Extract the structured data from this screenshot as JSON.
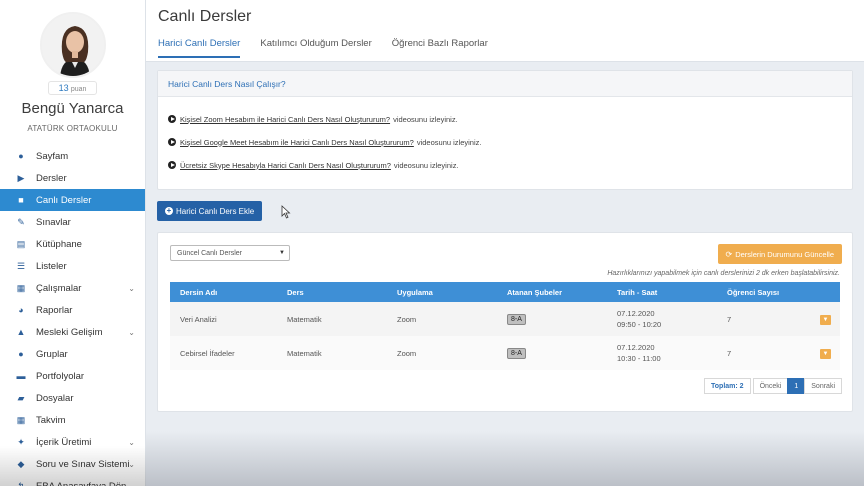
{
  "profile": {
    "points": "13",
    "points_label": "puan",
    "name": "Bengü Yanarca",
    "school": "ATATÜRK ORTAOKULU"
  },
  "sidebar": {
    "items": [
      {
        "label": "Sayfam",
        "icon": "user-icon",
        "glyph": "●"
      },
      {
        "label": "Dersler",
        "icon": "play-circle-icon",
        "glyph": "▶"
      },
      {
        "label": "Canlı Dersler",
        "icon": "video-camera-icon",
        "glyph": "■"
      },
      {
        "label": "Sınavlar",
        "icon": "pencil-icon",
        "glyph": "✎"
      },
      {
        "label": "Kütüphane",
        "icon": "book-icon",
        "glyph": "▤"
      },
      {
        "label": "Listeler",
        "icon": "list-icon",
        "glyph": "☰"
      },
      {
        "label": "Çalışmalar",
        "icon": "tasks-icon",
        "glyph": "▦"
      },
      {
        "label": "Raporlar",
        "icon": "pie-chart-icon",
        "glyph": "◕"
      },
      {
        "label": "Mesleki Gelişim",
        "icon": "graduation-icon",
        "glyph": "▲"
      },
      {
        "label": "Gruplar",
        "icon": "users-icon",
        "glyph": "●"
      },
      {
        "label": "Portfolyolar",
        "icon": "briefcase-icon",
        "glyph": "▬"
      },
      {
        "label": "Dosyalar",
        "icon": "folder-icon",
        "glyph": "▰"
      },
      {
        "label": "Takvim",
        "icon": "calendar-icon",
        "glyph": "▦"
      },
      {
        "label": "İçerik Üretimi",
        "icon": "content-icon",
        "glyph": "✦"
      },
      {
        "label": "Soru ve Sınav Sistemi",
        "icon": "question-icon",
        "glyph": "◆"
      },
      {
        "label": "EBA Anasayfaya Dön",
        "icon": "back-arrow-icon",
        "glyph": "↰"
      }
    ],
    "active_index": 2
  },
  "page": {
    "title": "Canlı Dersler",
    "tabs": [
      "Harici Canlı Dersler",
      "Katılımcı Olduğum Dersler",
      "Öğrenci Bazlı Raporlar"
    ],
    "active_tab": 0
  },
  "info": {
    "title": "Harici Canlı Ders Nasıl Çalışır?",
    "rows": [
      {
        "link": "Kişisel Zoom Hesabım ile Harici Canlı Ders Nasıl Oluştururum?",
        "suffix": "videosunu izleyiniz."
      },
      {
        "link": "Kişisel Google Meet Hesabım ile Harici Canlı Ders Nasıl Oluştururum?",
        "suffix": "videosunu izleyiniz."
      },
      {
        "link": "Ücretsiz Skype Hesabıyla Harici Canlı Ders Nasıl Oluştururum?",
        "suffix": "videosunu izleyiniz."
      }
    ]
  },
  "add_button": "Harici Canlı Ders Ekle",
  "filter": {
    "selected": "Güncel Canlı Dersler"
  },
  "update_button": "Derslerin Durumunu Güncelle",
  "hint": "Hazırlıklarınızı yapabilmek için canlı derslerinizi 2 dk erken başlatabilirsiniz.",
  "table": {
    "headers": [
      "Dersin Adı",
      "Ders",
      "Uygulama",
      "Atanan Şubeler",
      "Tarih - Saat",
      "Öğrenci Sayısı"
    ],
    "rows": [
      {
        "name": "Veri Analizi",
        "course": "Matematik",
        "app": "Zoom",
        "branch": "8-A",
        "date": "07.12.2020",
        "time": "09:50 - 10:20",
        "students": "7"
      },
      {
        "name": "Cebirsel İfadeler",
        "course": "Matematik",
        "app": "Zoom",
        "branch": "8-A",
        "date": "07.12.2020",
        "time": "10:30 - 11:00",
        "students": "7"
      }
    ]
  },
  "pager": {
    "total": "Toplam: 2",
    "prev": "Önceki",
    "current": "1",
    "next": "Sonraki"
  },
  "colors": {
    "accent": "#2d8ad0",
    "header_blue": "#3e8fd6",
    "button_blue": "#2561a6",
    "orange": "#f0ad4e"
  }
}
